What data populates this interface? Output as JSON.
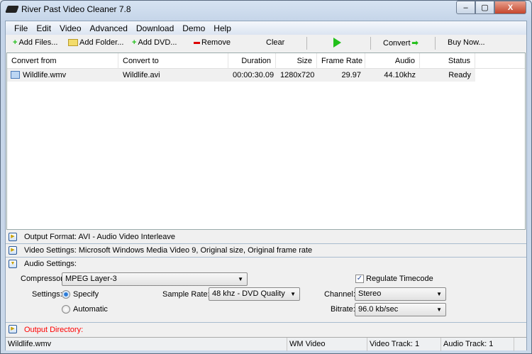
{
  "window": {
    "title": "River Past Video Cleaner 7.8",
    "min": "–",
    "max": "▢",
    "close": "X"
  },
  "menu": [
    "File",
    "Edit",
    "Video",
    "Advanced",
    "Download",
    "Demo",
    "Help"
  ],
  "toolbar": {
    "add_files": "Add Files...",
    "add_folder": "Add Folder...",
    "add_dvd": "Add DVD...",
    "remove": "Remove",
    "clear": "Clear",
    "convert": "Convert",
    "buy": "Buy Now..."
  },
  "list": {
    "headers": [
      "Convert from",
      "Convert to",
      "Duration",
      "Size",
      "Frame Rate",
      "Audio",
      "Status"
    ],
    "rows": [
      [
        "Wildlife.wmv",
        "Wildlife.avi",
        "00:00:30.09",
        "1280x720",
        "29.97",
        "44.10khz",
        "Ready"
      ]
    ]
  },
  "panels": {
    "output_format": "Output Format: AVI - Audio Video Interleave",
    "video_settings": "Video Settings: Microsoft Windows Media Video 9, Original size, Original frame rate",
    "audio_settings": "Audio Settings:",
    "output_directory": "Output Directory:"
  },
  "audio": {
    "compressor_label": "Compressor:",
    "compressor": "MPEG Layer-3",
    "regulate_timecode": "Regulate Timecode",
    "regulate_checked": true,
    "settings_label": "Settings:",
    "specify": "Specify",
    "automatic": "Automatic",
    "sample_rate_label": "Sample Rate:",
    "sample_rate": "48 khz - DVD Quality",
    "channel_label": "Channel:",
    "channel": "Stereo",
    "bitrate_label": "Bitrate:",
    "bitrate": "96.0 kb/sec"
  },
  "status": [
    "Wildlife.wmv",
    "WM Video",
    "Video Track: 1",
    "Audio Track: 1"
  ],
  "colors": {
    "output_dir": "#ff0000",
    "green": "#22c01a"
  }
}
